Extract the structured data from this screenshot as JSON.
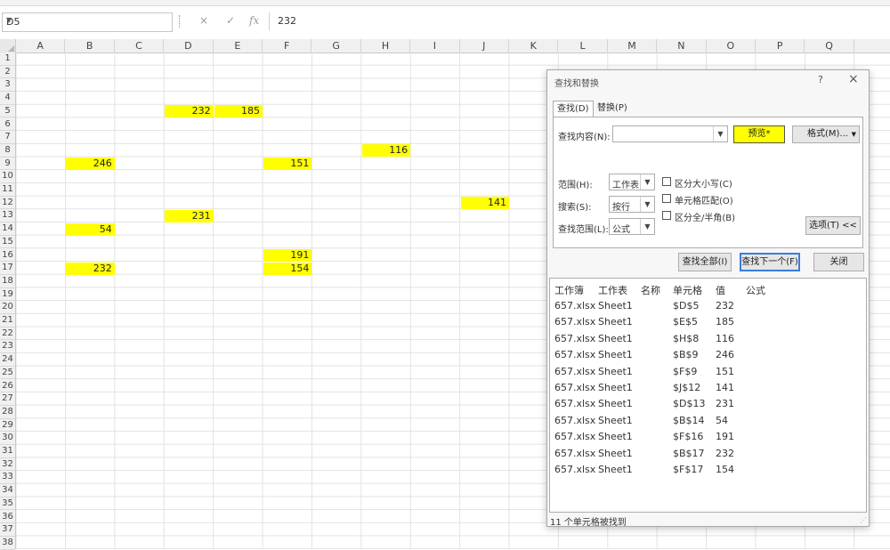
{
  "formula_bar": {
    "name_box": "D5",
    "cancel_icon": "×",
    "enter_icon": "✓",
    "fx_icon": "fx",
    "value": "232"
  },
  "columns": [
    "A",
    "B",
    "C",
    "D",
    "E",
    "F",
    "G",
    "H",
    "I",
    "J",
    "K",
    "L",
    "M",
    "N",
    "O",
    "P",
    "Q"
  ],
  "rows": [
    "1",
    "2",
    "3",
    "4",
    "5",
    "6",
    "7",
    "8",
    "9",
    "10",
    "11",
    "12",
    "13",
    "14",
    "15",
    "16",
    "17",
    "18",
    "19",
    "20",
    "21",
    "22",
    "23",
    "24",
    "25",
    "26",
    "27",
    "28",
    "29",
    "30",
    "31",
    "32",
    "33",
    "34",
    "35",
    "36",
    "37",
    "38"
  ],
  "cells": [
    {
      "col": "D",
      "row": 5,
      "value": "232"
    },
    {
      "col": "E",
      "row": 5,
      "value": "185"
    },
    {
      "col": "H",
      "row": 8,
      "value": "116"
    },
    {
      "col": "B",
      "row": 9,
      "value": "246"
    },
    {
      "col": "F",
      "row": 9,
      "value": "151"
    },
    {
      "col": "J",
      "row": 12,
      "value": "141"
    },
    {
      "col": "D",
      "row": 13,
      "value": "231"
    },
    {
      "col": "B",
      "row": 14,
      "value": "54"
    },
    {
      "col": "F",
      "row": 16,
      "value": "191"
    },
    {
      "col": "B",
      "row": 17,
      "value": "232"
    },
    {
      "col": "F",
      "row": 17,
      "value": "154"
    }
  ],
  "highlight_color": "#ffff00",
  "dialog": {
    "title": "查找和替换",
    "help": "?",
    "close": "×",
    "tabs": [
      "查找(D)",
      "替换(P)"
    ],
    "find_label": "查找内容(N):",
    "find_value": "",
    "preview_label": "预览*",
    "format_label": "格式(M)...",
    "within_label": "范围(H):",
    "within_value": "工作表",
    "search_label": "搜索(S):",
    "search_value": "按行",
    "lookin_label": "查找范围(L):",
    "lookin_value": "公式",
    "opt_case": "区分大小写(C)",
    "opt_whole": "单元格匹配(O)",
    "opt_width": "区分全/半角(B)",
    "options_btn": "选项(T) <<",
    "find_all": "查找全部(I)",
    "find_next": "查找下一个(F)",
    "close_btn": "关闭",
    "result_headers": [
      "工作簿",
      "工作表",
      "名称",
      "单元格",
      "值",
      "公式"
    ],
    "results": [
      {
        "book": "657.xlsx",
        "sheet": "Sheet1",
        "name": "",
        "cell": "$D$5",
        "value": "232",
        "formula": ""
      },
      {
        "book": "657.xlsx",
        "sheet": "Sheet1",
        "name": "",
        "cell": "$E$5",
        "value": "185",
        "formula": ""
      },
      {
        "book": "657.xlsx",
        "sheet": "Sheet1",
        "name": "",
        "cell": "$H$8",
        "value": "116",
        "formula": ""
      },
      {
        "book": "657.xlsx",
        "sheet": "Sheet1",
        "name": "",
        "cell": "$B$9",
        "value": "246",
        "formula": ""
      },
      {
        "book": "657.xlsx",
        "sheet": "Sheet1",
        "name": "",
        "cell": "$F$9",
        "value": "151",
        "formula": ""
      },
      {
        "book": "657.xlsx",
        "sheet": "Sheet1",
        "name": "",
        "cell": "$J$12",
        "value": "141",
        "formula": ""
      },
      {
        "book": "657.xlsx",
        "sheet": "Sheet1",
        "name": "",
        "cell": "$D$13",
        "value": "231",
        "formula": ""
      },
      {
        "book": "657.xlsx",
        "sheet": "Sheet1",
        "name": "",
        "cell": "$B$14",
        "value": "54",
        "formula": ""
      },
      {
        "book": "657.xlsx",
        "sheet": "Sheet1",
        "name": "",
        "cell": "$F$16",
        "value": "191",
        "formula": ""
      },
      {
        "book": "657.xlsx",
        "sheet": "Sheet1",
        "name": "",
        "cell": "$B$17",
        "value": "232",
        "formula": ""
      },
      {
        "book": "657.xlsx",
        "sheet": "Sheet1",
        "name": "",
        "cell": "$F$17",
        "value": "154",
        "formula": ""
      }
    ],
    "status": "11 个单元格被找到"
  }
}
